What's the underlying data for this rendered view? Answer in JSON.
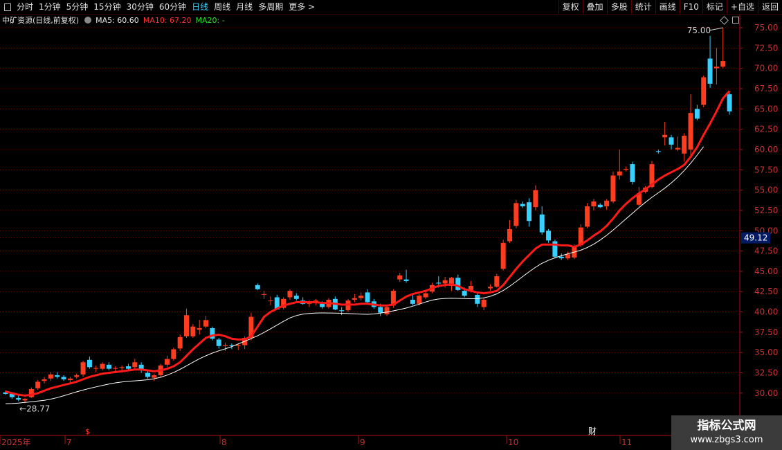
{
  "toolbar": {
    "left": [
      "分时",
      "1分钟",
      "5分钟",
      "15分钟",
      "30分钟",
      "60分钟",
      "日线",
      "周线",
      "月线",
      "多周期",
      "更多 >"
    ],
    "active": "日线",
    "right": [
      "复权",
      "叠加",
      "多股",
      "统计",
      "画线",
      "F10",
      "标记",
      "+自选",
      "返回"
    ]
  },
  "info": {
    "stock": "中矿资源(日线,前复权)",
    "ma5": "MA5: 60.60",
    "ma10": "MA10: 67.20",
    "ma20": "MA20: -"
  },
  "colors": {
    "up": "#ff3c1e",
    "down": "#38d0ff",
    "ma10": "#ff1a1a",
    "ma20": "#ffffff",
    "grid": "#6e0000",
    "axis": "#b01010"
  },
  "watermark": {
    "line1": "指标公式网",
    "line2": "www.zbgs3.com"
  },
  "chart_data": {
    "type": "candlestick",
    "title": "中矿资源(日线,前复权)",
    "y_ticks": [
      "75.00",
      "72.50",
      "70.00",
      "67.50",
      "65.00",
      "62.50",
      "60.00",
      "57.50",
      "55.00",
      "52.50",
      "50.00",
      "47.50",
      "45.00",
      "42.50",
      "40.00",
      "37.50",
      "35.00",
      "32.50",
      "30.00"
    ],
    "ylim": [
      28.5,
      75.5
    ],
    "current_price_label": "49.12",
    "x_labels": [
      "2025年",
      "7",
      "8",
      "9",
      "10",
      "11"
    ],
    "markers": [
      "$",
      "财"
    ],
    "annotations": {
      "high": "75.00",
      "low": "28.77"
    },
    "candles": [
      [
        30.1,
        30.3,
        29.8,
        29.9
      ],
      [
        29.9,
        30.0,
        29.3,
        29.5
      ],
      [
        29.4,
        29.7,
        29.0,
        29.2
      ],
      [
        29.1,
        29.4,
        28.77,
        29.3
      ],
      [
        29.5,
        30.7,
        29.4,
        30.5
      ],
      [
        30.6,
        31.6,
        30.4,
        31.4
      ],
      [
        31.5,
        32.0,
        31.2,
        31.7
      ],
      [
        31.8,
        32.6,
        31.5,
        32.3
      ],
      [
        32.2,
        32.6,
        31.8,
        32.0
      ],
      [
        32.0,
        32.2,
        31.5,
        31.7
      ],
      [
        31.6,
        32.0,
        31.3,
        31.8
      ],
      [
        32.0,
        32.4,
        31.8,
        32.2
      ],
      [
        32.3,
        34.0,
        32.0,
        33.8
      ],
      [
        34.1,
        34.5,
        33.0,
        33.2
      ],
      [
        33.0,
        33.4,
        32.6,
        33.1
      ],
      [
        33.0,
        33.8,
        32.8,
        33.6
      ],
      [
        33.5,
        33.8,
        32.8,
        33.0
      ],
      [
        33.0,
        33.3,
        32.6,
        33.1
      ],
      [
        33.1,
        33.4,
        32.8,
        33.2
      ],
      [
        33.3,
        33.6,
        32.9,
        33.0
      ],
      [
        33.2,
        34.2,
        33.0,
        33.8
      ],
      [
        33.5,
        33.8,
        32.5,
        32.8
      ],
      [
        32.5,
        32.8,
        31.8,
        32.0
      ],
      [
        31.9,
        32.4,
        31.5,
        32.2
      ],
      [
        32.2,
        33.6,
        32.0,
        33.4
      ],
      [
        33.5,
        34.6,
        33.2,
        34.2
      ],
      [
        34.2,
        35.6,
        34.0,
        35.4
      ],
      [
        35.5,
        37.2,
        35.2,
        36.9
      ],
      [
        37.0,
        40.4,
        36.8,
        39.6
      ],
      [
        37.0,
        38.5,
        36.8,
        38.2
      ],
      [
        37.8,
        39.0,
        37.2,
        38.0
      ],
      [
        38.2,
        39.5,
        38.0,
        39.0
      ],
      [
        38.0,
        38.2,
        36.5,
        36.7
      ],
      [
        36.6,
        36.8,
        35.5,
        35.8
      ],
      [
        35.8,
        36.2,
        35.2,
        35.9
      ],
      [
        35.9,
        36.1,
        35.4,
        35.8
      ],
      [
        35.8,
        36.1,
        35.3,
        35.9
      ],
      [
        35.9,
        37.0,
        35.4,
        36.8
      ],
      [
        36.8,
        39.9,
        36.5,
        39.4
      ],
      [
        43.3,
        43.5,
        42.7,
        42.8
      ],
      [
        42.1,
        42.6,
        41.6,
        42.2
      ],
      [
        41.4,
        41.9,
        40.8,
        41.4
      ],
      [
        41.8,
        42.1,
        40.5,
        40.3
      ],
      [
        40.5,
        41.8,
        40.3,
        41.6
      ],
      [
        41.8,
        42.8,
        41.5,
        42.6
      ],
      [
        42.0,
        42.3,
        41.4,
        41.6
      ],
      [
        41.4,
        41.8,
        40.9,
        41.0
      ],
      [
        41.0,
        41.4,
        40.6,
        41.1
      ],
      [
        41.1,
        41.6,
        40.8,
        41.4
      ],
      [
        41.0,
        41.3,
        40.4,
        40.6
      ],
      [
        40.6,
        41.7,
        40.4,
        41.5
      ],
      [
        41.6,
        41.9,
        40.2,
        40.3
      ],
      [
        40.2,
        40.6,
        39.6,
        40.1
      ],
      [
        40.2,
        41.6,
        40.0,
        41.4
      ],
      [
        41.5,
        42.2,
        41.2,
        41.7
      ],
      [
        41.7,
        42.4,
        41.4,
        42.0
      ],
      [
        42.4,
        42.8,
        41.0,
        41.2
      ],
      [
        41.3,
        41.6,
        40.4,
        40.6
      ],
      [
        40.6,
        41.0,
        39.5,
        39.9
      ],
      [
        39.7,
        40.8,
        39.5,
        40.6
      ],
      [
        40.8,
        42.8,
        40.5,
        42.6
      ],
      [
        44.0,
        44.8,
        43.7,
        44.5
      ],
      [
        44.0,
        45.2,
        43.6,
        43.8
      ],
      [
        41.5,
        42.2,
        40.8,
        41.0
      ],
      [
        41.0,
        42.2,
        40.8,
        42.0
      ],
      [
        41.8,
        42.6,
        41.6,
        42.3
      ],
      [
        42.5,
        43.6,
        42.3,
        43.3
      ],
      [
        43.6,
        44.4,
        43.0,
        43.5
      ],
      [
        43.5,
        44.3,
        43.0,
        43.9
      ],
      [
        43.2,
        44.3,
        42.6,
        44.2
      ],
      [
        44.2,
        44.6,
        42.6,
        42.7
      ],
      [
        42.6,
        43.0,
        41.8,
        42.0
      ],
      [
        42.7,
        43.8,
        42.4,
        43.2
      ],
      [
        42.1,
        42.5,
        40.6,
        41.0
      ],
      [
        40.6,
        41.8,
        40.2,
        41.5
      ],
      [
        42.9,
        43.4,
        42.6,
        43.1
      ],
      [
        43.1,
        44.7,
        43.0,
        44.4
      ],
      [
        45.3,
        48.9,
        45.1,
        48.5
      ],
      [
        48.7,
        51.3,
        48.5,
        50.2
      ],
      [
        50.6,
        53.8,
        50.3,
        53.4
      ],
      [
        53.3,
        53.6,
        52.8,
        53.0
      ],
      [
        53.5,
        54.0,
        50.5,
        51.2
      ],
      [
        52.9,
        55.6,
        52.5,
        55.0
      ],
      [
        52.0,
        53.0,
        49.5,
        49.8
      ],
      [
        50.0,
        50.2,
        48.5,
        48.8
      ],
      [
        48.7,
        48.9,
        46.6,
        46.8
      ],
      [
        46.8,
        47.2,
        46.4,
        46.6
      ],
      [
        46.6,
        47.4,
        46.4,
        47.1
      ],
      [
        46.7,
        48.3,
        46.5,
        48.1
      ],
      [
        48.2,
        50.8,
        48.0,
        50.4
      ],
      [
        50.5,
        53.4,
        50.3,
        53.0
      ],
      [
        53.0,
        53.9,
        52.5,
        53.6
      ],
      [
        53.2,
        53.4,
        52.8,
        52.9
      ],
      [
        53.0,
        53.9,
        52.6,
        53.7
      ],
      [
        53.6,
        57.3,
        53.4,
        56.8
      ],
      [
        56.8,
        60.0,
        56.3,
        57.3
      ],
      [
        57.5,
        57.9,
        57.3,
        57.6
      ],
      [
        58.2,
        58.5,
        55.7,
        56.0
      ],
      [
        53.2,
        55.4,
        53.0,
        54.6
      ],
      [
        54.8,
        55.5,
        54.6,
        55.3
      ],
      [
        55.4,
        58.6,
        55.2,
        58.2
      ],
      [
        59.8,
        60.0,
        59.5,
        59.7
      ],
      [
        61.5,
        63.4,
        60.5,
        61.8
      ],
      [
        61.5,
        61.8,
        60.0,
        60.6
      ],
      [
        60.0,
        61.6,
        59.8,
        60.2
      ],
      [
        59.5,
        62.0,
        58.5,
        61.7
      ],
      [
        60.0,
        66.8,
        59.0,
        64.5
      ],
      [
        65.0,
        65.5,
        63.6,
        63.8
      ],
      [
        65.5,
        69.1,
        65.2,
        68.9
      ],
      [
        71.2,
        74.0,
        67.6,
        68.1
      ],
      [
        70.0,
        72.5,
        68.0,
        70.2
      ],
      [
        70.2,
        75.0,
        70.0,
        70.9
      ],
      [
        66.8,
        67.0,
        64.3,
        64.7
      ]
    ],
    "ma10": [
      30.2,
      30.0,
      29.8,
      29.7,
      29.8,
      30.0,
      30.3,
      30.6,
      30.8,
      31.0,
      31.2,
      31.4,
      31.7,
      32.0,
      32.2,
      32.4,
      32.5,
      32.6,
      32.7,
      32.8,
      32.9,
      32.9,
      32.8,
      32.7,
      32.8,
      33.0,
      33.3,
      33.8,
      34.6,
      35.4,
      36.1,
      36.8,
      37.1,
      37.2,
      37.0,
      36.7,
      36.6,
      36.6,
      37.0,
      38.2,
      39.4,
      40.0,
      40.4,
      40.8,
      41.0,
      41.2,
      41.2,
      41.2,
      41.2,
      41.1,
      41.1,
      41.0,
      40.9,
      40.9,
      40.9,
      41.0,
      41.0,
      40.9,
      40.8,
      40.8,
      40.9,
      41.4,
      41.9,
      42.2,
      42.4,
      42.6,
      42.9,
      43.2,
      43.3,
      43.4,
      43.2,
      42.8,
      42.6,
      42.4,
      42.3,
      42.4,
      42.6,
      43.3,
      44.3,
      45.3,
      46.2,
      47.0,
      47.8,
      48.3,
      48.3,
      48.3,
      48.2,
      48.2,
      48.0,
      48.3,
      48.8,
      49.4,
      49.9,
      50.6,
      51.5,
      52.5,
      53.3,
      54.0,
      54.6,
      55.1,
      55.7,
      56.3,
      56.8,
      57.2,
      57.6,
      58.1,
      59.1,
      60.3,
      61.8,
      63.2,
      64.7,
      66.3,
      67.2
    ],
    "ma20": [
      null,
      null,
      null,
      null,
      null,
      null,
      null,
      null,
      null,
      null,
      null,
      null,
      null,
      null,
      null,
      null,
      null,
      null,
      null,
      null,
      null,
      null,
      null,
      null,
      null,
      null,
      null,
      null,
      null,
      null,
      null,
      null,
      null,
      null,
      null,
      null,
      null,
      null,
      null,
      null,
      null,
      null,
      null,
      null,
      null,
      null,
      null,
      null,
      null,
      null,
      null,
      null,
      null,
      null,
      null,
      null,
      null,
      null,
      null,
      null,
      null,
      null,
      null,
      null,
      null,
      null,
      null,
      null,
      null,
      null,
      null,
      null,
      null,
      null,
      null,
      null,
      null,
      null,
      null,
      null,
      null,
      null,
      null,
      null,
      null,
      null,
      null,
      null,
      null,
      null,
      null,
      null,
      null,
      null,
      null,
      null,
      null,
      null,
      null,
      null,
      null,
      null,
      null,
      null,
      null,
      null,
      null,
      null,
      null,
      null,
      null,
      null,
      null
    ]
  }
}
